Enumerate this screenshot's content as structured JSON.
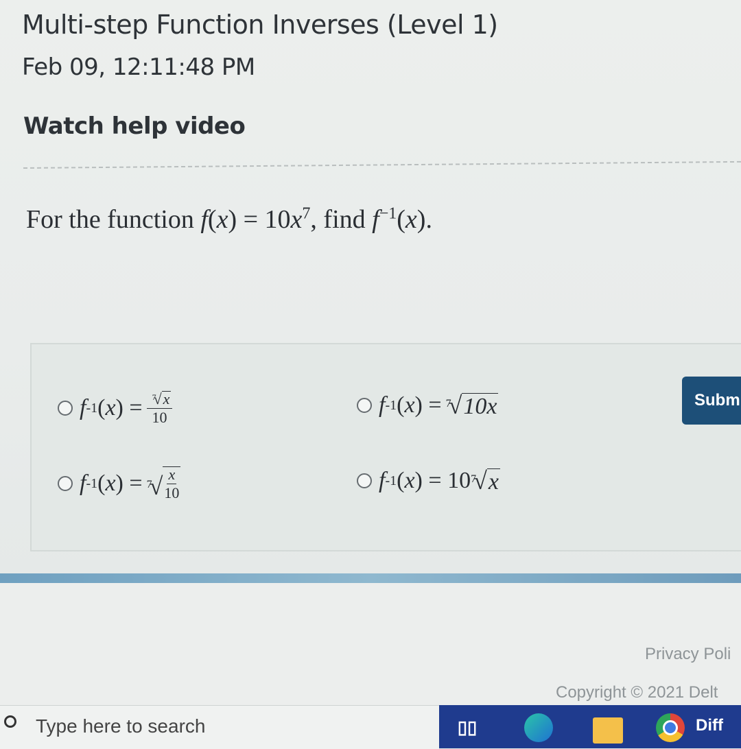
{
  "header": {
    "title": "Multi-step Function Inverses (Level 1)",
    "date": "Feb 09, 12:11:48 PM",
    "help_link": "Watch help video"
  },
  "question": {
    "prefix": "For the function ",
    "f": "f",
    "x": "x",
    "equals_coef": "10",
    "exp": "7",
    "find": ", find ",
    "inv_exp": "−1",
    "end": "."
  },
  "choices": [
    {
      "label": "f⁻¹(x) = ⁷√x / 10"
    },
    {
      "label": "f⁻¹(x) = ⁷√(10x)"
    },
    {
      "label": "f⁻¹(x) = ⁷√(x/10)"
    },
    {
      "label": "f⁻¹(x) = 10 ⁷√x"
    }
  ],
  "math": {
    "f": "f",
    "inv": "-1",
    "x": "x",
    "ten": "10",
    "seven": "7",
    "lparen": "(",
    "rparen": ")",
    "eq": "=",
    "root": "√",
    "ten_x": "10x"
  },
  "submit_label": "Subm",
  "footer": {
    "privacy": "Privacy Poli",
    "copyright": "Copyright © 2021 Delt"
  },
  "taskbar": {
    "search_placeholder": "Type here to search",
    "diff_label": "Diff"
  },
  "colors": {
    "submit_bg": "#1d4f78",
    "taskbar_bg": "#1f3b8e"
  }
}
